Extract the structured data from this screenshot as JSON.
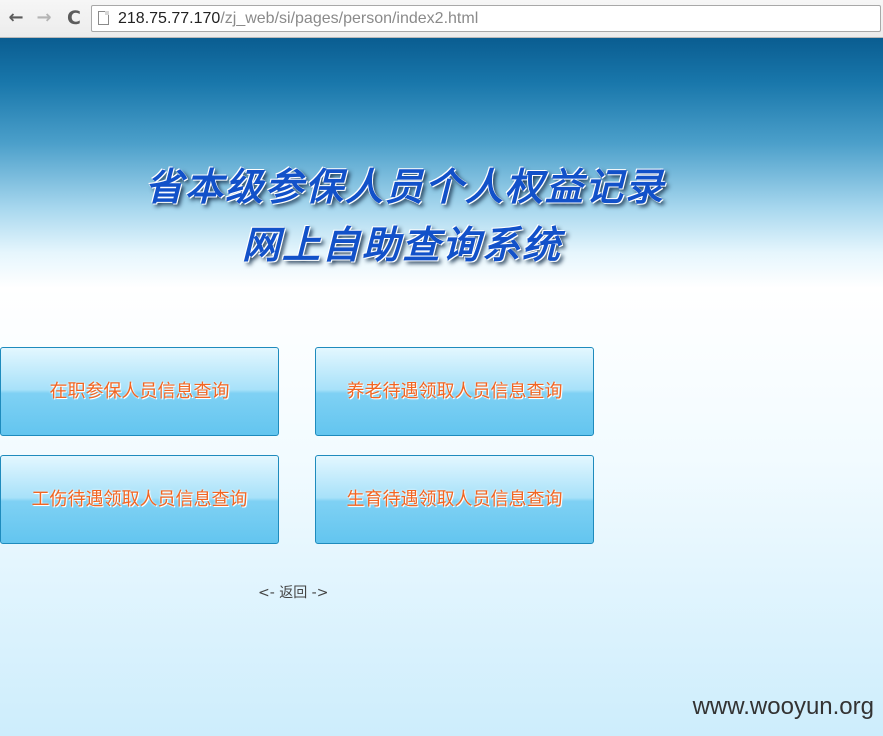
{
  "browser": {
    "back_icon": "back-arrow-icon",
    "back_glyph": "←",
    "forward_icon": "forward-arrow-icon",
    "forward_glyph": "→",
    "reload_icon": "reload-icon",
    "reload_glyph": "C",
    "url_host": "218.75.77.170",
    "url_path": "/zj_web/si/pages/person/index2.html"
  },
  "header": {
    "title_line1": "省本级参保人员个人权益记录",
    "title_line2": "网上自助查询系统",
    "title_color": "#1251c9",
    "band_color": "#0a5d91"
  },
  "buttons": {
    "on_job": "在职参保人员信息查询",
    "pension": "养老待遇领取人员信息查询",
    "injury": "工伤待遇领取人员信息查询",
    "maternity": "生育待遇领取人员信息查询",
    "label_color": "#f26522"
  },
  "footer": {
    "back_link": "<- 返回 ->",
    "watermark": "www.wooyun.org"
  }
}
